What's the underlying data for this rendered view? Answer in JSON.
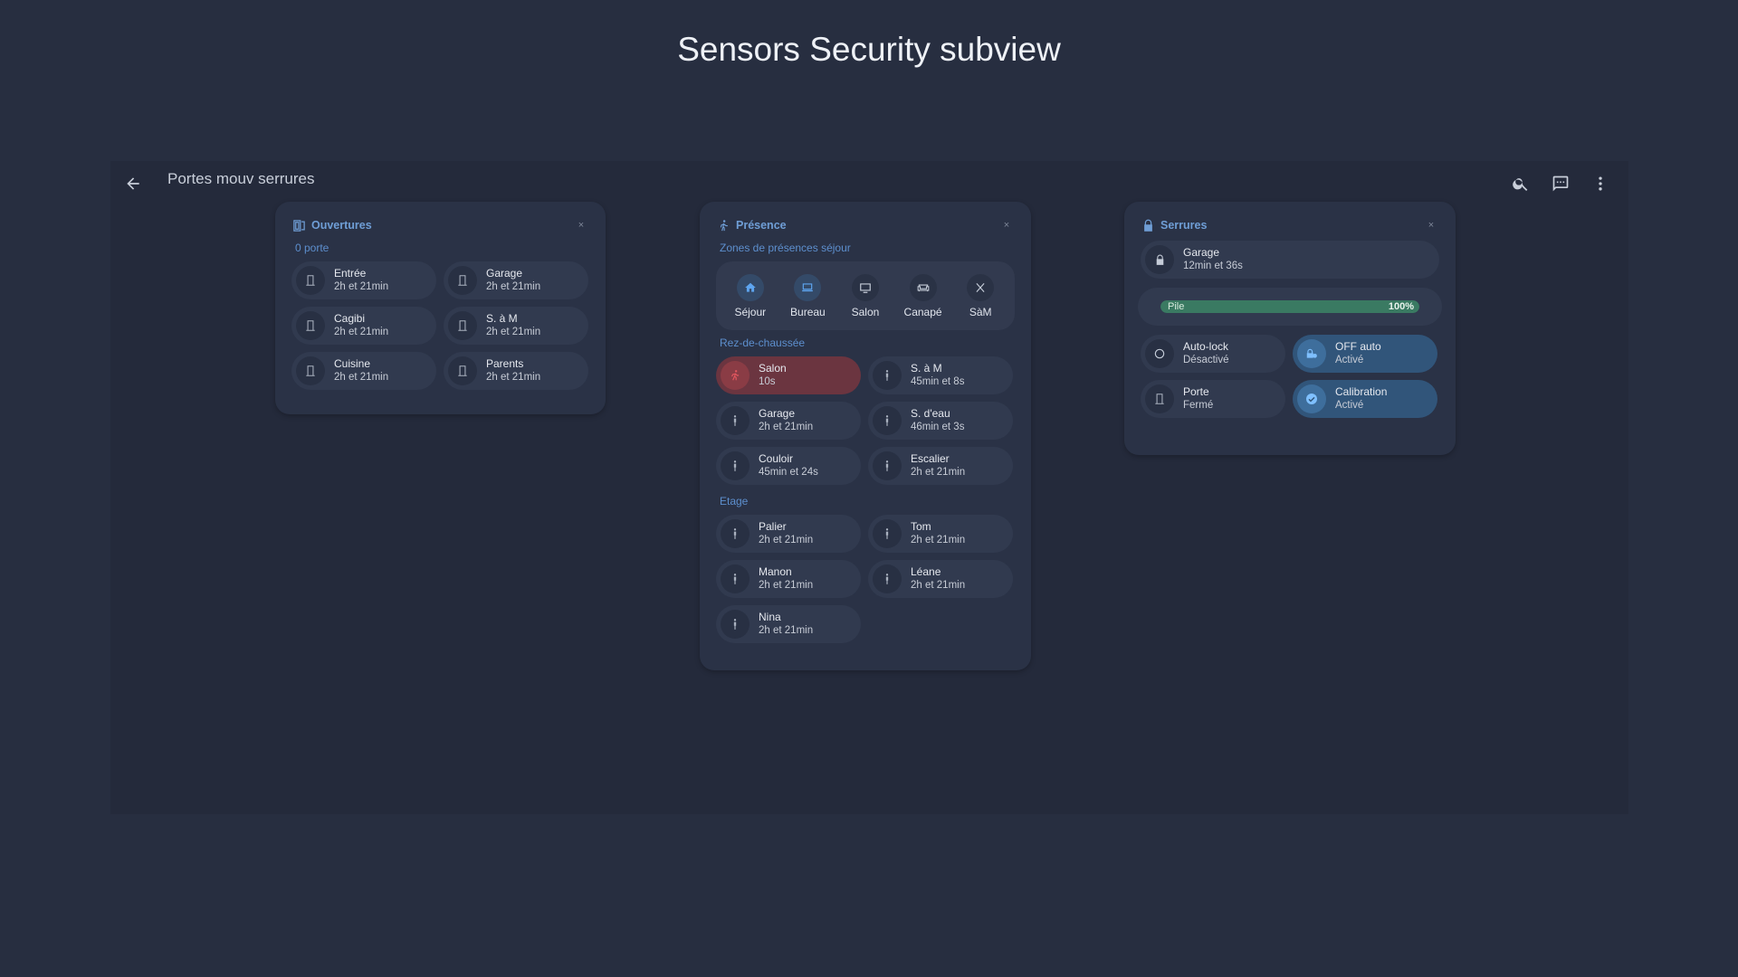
{
  "page": {
    "title": "Sensors Security subview"
  },
  "topbar": {
    "title": "Portes mouv serrures",
    "icons": {
      "back": "arrow-left-icon",
      "search": "search-icon",
      "chat": "chat-icon",
      "menu": "dots-vertical-icon"
    }
  },
  "ouvertures": {
    "title": "Ouvertures",
    "subtitle": "0 porte",
    "close": "×",
    "items": [
      {
        "name": "Entrée",
        "state": "2h et 21min"
      },
      {
        "name": "Garage",
        "state": "2h et 21min"
      },
      {
        "name": "Cagibi",
        "state": "2h et 21min"
      },
      {
        "name": "S. à M",
        "state": "2h et 21min"
      },
      {
        "name": "Cuisine",
        "state": "2h et 21min"
      },
      {
        "name": "Parents",
        "state": "2h et 21min"
      }
    ]
  },
  "presence": {
    "title": "Présence",
    "close": "×",
    "zones_title": "Zones de présences séjour",
    "zones": [
      {
        "label": "Séjour",
        "icon": "home-icon",
        "active": true
      },
      {
        "label": "Bureau",
        "icon": "laptop-icon",
        "active": true
      },
      {
        "label": "Salon",
        "icon": "tv-icon",
        "active": false
      },
      {
        "label": "Canapé",
        "icon": "sofa-icon",
        "active": false
      },
      {
        "label": "SàM",
        "icon": "utensils-icon",
        "active": false
      }
    ],
    "rdc_title": "Rez-de-chaussée",
    "rdc": [
      {
        "name": "Salon",
        "state": "10s",
        "alert": true
      },
      {
        "name": "S. à M",
        "state": "45min et 8s"
      },
      {
        "name": "Garage",
        "state": "2h et 21min"
      },
      {
        "name": "S. d'eau",
        "state": "46min et 3s"
      },
      {
        "name": "Couloir",
        "state": "45min et 24s"
      },
      {
        "name": "Escalier",
        "state": "2h et 21min"
      }
    ],
    "etage_title": "Etage",
    "etage": [
      {
        "name": "Palier",
        "state": "2h et 21min"
      },
      {
        "name": "Tom",
        "state": "2h et 21min"
      },
      {
        "name": "Manon",
        "state": "2h et 21min"
      },
      {
        "name": "Léane",
        "state": "2h et 21min"
      },
      {
        "name": "Nina",
        "state": "2h et 21min"
      }
    ]
  },
  "serrures": {
    "title": "Serrures",
    "close": "×",
    "lock": {
      "name": "Garage",
      "state": "12min et 36s"
    },
    "battery": {
      "label": "Pile",
      "value_text": "100%",
      "level": 1.0
    },
    "toggles": [
      {
        "name": "Auto-lock",
        "state": "Désactivé",
        "icon": "circle-outline-icon",
        "active": false
      },
      {
        "name": "OFF auto",
        "state": "Activé",
        "icon": "lock-clock-icon",
        "active": true
      },
      {
        "name": "Porte",
        "state": "Fermé",
        "icon": "door-icon",
        "active": false
      },
      {
        "name": "Calibration",
        "state": "Activé",
        "icon": "check-circle-icon",
        "active": true
      }
    ]
  },
  "colors": {
    "accent": "#6f9ed6",
    "alert": "#6b3540",
    "active": "#31557a",
    "battery": "#3a7a62"
  }
}
